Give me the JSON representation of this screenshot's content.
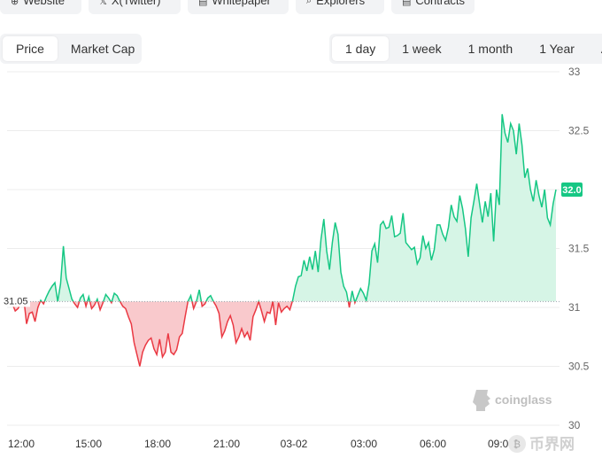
{
  "top_links": [
    {
      "icon": "globe-icon",
      "glyph": "⊕",
      "label": "Website"
    },
    {
      "icon": "x-icon",
      "glyph": "𝕏",
      "label": "X(Twitter)"
    },
    {
      "icon": "document-icon",
      "glyph": "▤",
      "label": "Whitepaper"
    },
    {
      "icon": "search-icon",
      "glyph": "⌕",
      "label": "Explorers"
    },
    {
      "icon": "contract-icon",
      "glyph": "▤",
      "label": "Contracts"
    }
  ],
  "metric_tabs": {
    "items": [
      "Price",
      "Market Cap"
    ],
    "active": "Price"
  },
  "range_tabs": {
    "items": [
      "1 day",
      "1 week",
      "1 month",
      "1 Year",
      "All"
    ],
    "active": "1 day"
  },
  "watermark": "coinglass",
  "corner_logo": {
    "text": "币界网",
    "icon": "bijie-logo-icon"
  },
  "colors": {
    "up": "#16c784",
    "up_fill": "#d6f5e6",
    "down": "#ea3943",
    "down_fill": "#f9c9cc",
    "badge": "#16c784",
    "grid": "#ececec"
  },
  "chart_data": {
    "type": "area",
    "baseline": 31.05,
    "baseline_label": "31.05",
    "current": 32.0,
    "current_label": "32.0",
    "ylim": [
      30,
      33
    ],
    "yticks": [
      "33",
      "32.5",
      "32",
      "31.5",
      "31",
      "30.5",
      "30"
    ],
    "xticks": [
      "12:00",
      "15:00",
      "18:00",
      "21:00",
      "03-02",
      "03:00",
      "06:00",
      "09:00"
    ],
    "x_start": "11:30",
    "x_interval_minutes": 5,
    "values": [
      31.03,
      30.97,
      30.99,
      31.04,
      31.08,
      30.86,
      30.95,
      30.96,
      30.88,
      31.0,
      31.06,
      31.03,
      31.09,
      31.14,
      31.18,
      31.21,
      31.05,
      31.2,
      31.52,
      31.25,
      31.16,
      31.07,
      31.03,
      31.0,
      31.08,
      31.11,
      31.01,
      31.09,
      30.99,
      31.02,
      31.07,
      30.98,
      31.04,
      31.11,
      31.08,
      31.04,
      31.12,
      31.1,
      31.05,
      31.01,
      30.99,
      30.92,
      30.86,
      30.7,
      30.6,
      30.5,
      30.62,
      30.68,
      30.72,
      30.74,
      30.65,
      30.6,
      30.73,
      30.58,
      30.62,
      30.78,
      30.62,
      30.6,
      30.64,
      30.75,
      30.78,
      30.92,
      31.05,
      31.1,
      30.99,
      31.05,
      31.15,
      31.01,
      31.03,
      31.08,
      31.1,
      31.05,
      31.01,
      30.95,
      30.75,
      30.8,
      30.88,
      30.93,
      30.85,
      30.7,
      30.75,
      30.82,
      30.75,
      30.79,
      30.72,
      30.92,
      30.98,
      31.05,
      30.97,
      30.88,
      30.96,
      30.95,
      31.05,
      30.85,
      31.04,
      30.96,
      30.99,
      31.01,
      30.98,
      31.06,
      31.18,
      31.26,
      31.27,
      31.4,
      31.31,
      31.43,
      31.32,
      31.48,
      31.3,
      31.58,
      31.75,
      31.48,
      31.32,
      31.55,
      31.72,
      31.62,
      31.3,
      31.18,
      31.13,
      31.0,
      31.14,
      31.04,
      31.1,
      31.16,
      31.12,
      31.06,
      31.2,
      31.48,
      31.54,
      31.38,
      31.7,
      31.73,
      31.67,
      31.68,
      31.78,
      31.6,
      31.61,
      31.63,
      31.8,
      31.55,
      31.52,
      31.49,
      31.51,
      31.37,
      31.42,
      31.61,
      31.5,
      31.55,
      31.4,
      31.49,
      31.7,
      31.7,
      31.62,
      31.57,
      31.68,
      31.87,
      31.77,
      31.73,
      31.95,
      31.84,
      31.67,
      31.43,
      31.76,
      31.9,
      32.05,
      31.88,
      31.72,
      31.9,
      31.77,
      31.97,
      31.56,
      32.0,
      31.87,
      32.64,
      32.48,
      32.4,
      32.56,
      32.5,
      32.3,
      32.56,
      32.38,
      32.1,
      32.18,
      32.0,
      31.9,
      32.08,
      31.95,
      31.85,
      32.0,
      31.76,
      31.7,
      31.88,
      32.0
    ]
  }
}
